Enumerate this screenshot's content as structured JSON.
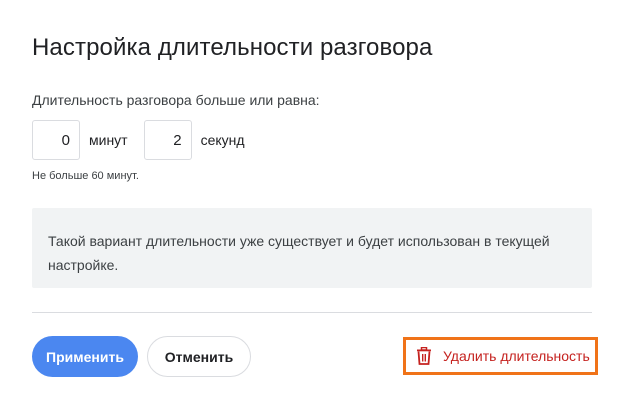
{
  "dialog": {
    "title": "Настройка длительности разговора",
    "subtitle": "Длительность разговора больше или равна:",
    "minutes": {
      "value": "0",
      "unit": "минут"
    },
    "seconds": {
      "value": "2",
      "unit": "секунд"
    },
    "hint": "Не больше 60 минут.",
    "notice": "Такой вариант длительности уже существует и будет использован в текущей настройке.",
    "apply_label": "Применить",
    "cancel_label": "Отменить",
    "delete_label": "Удалить длительность"
  },
  "colors": {
    "primary": "#4b87f0",
    "danger": "#c5221f",
    "highlight": "#f07318",
    "notice_bg": "#f1f3f4"
  },
  "icons": {
    "delete": "trash-icon"
  }
}
